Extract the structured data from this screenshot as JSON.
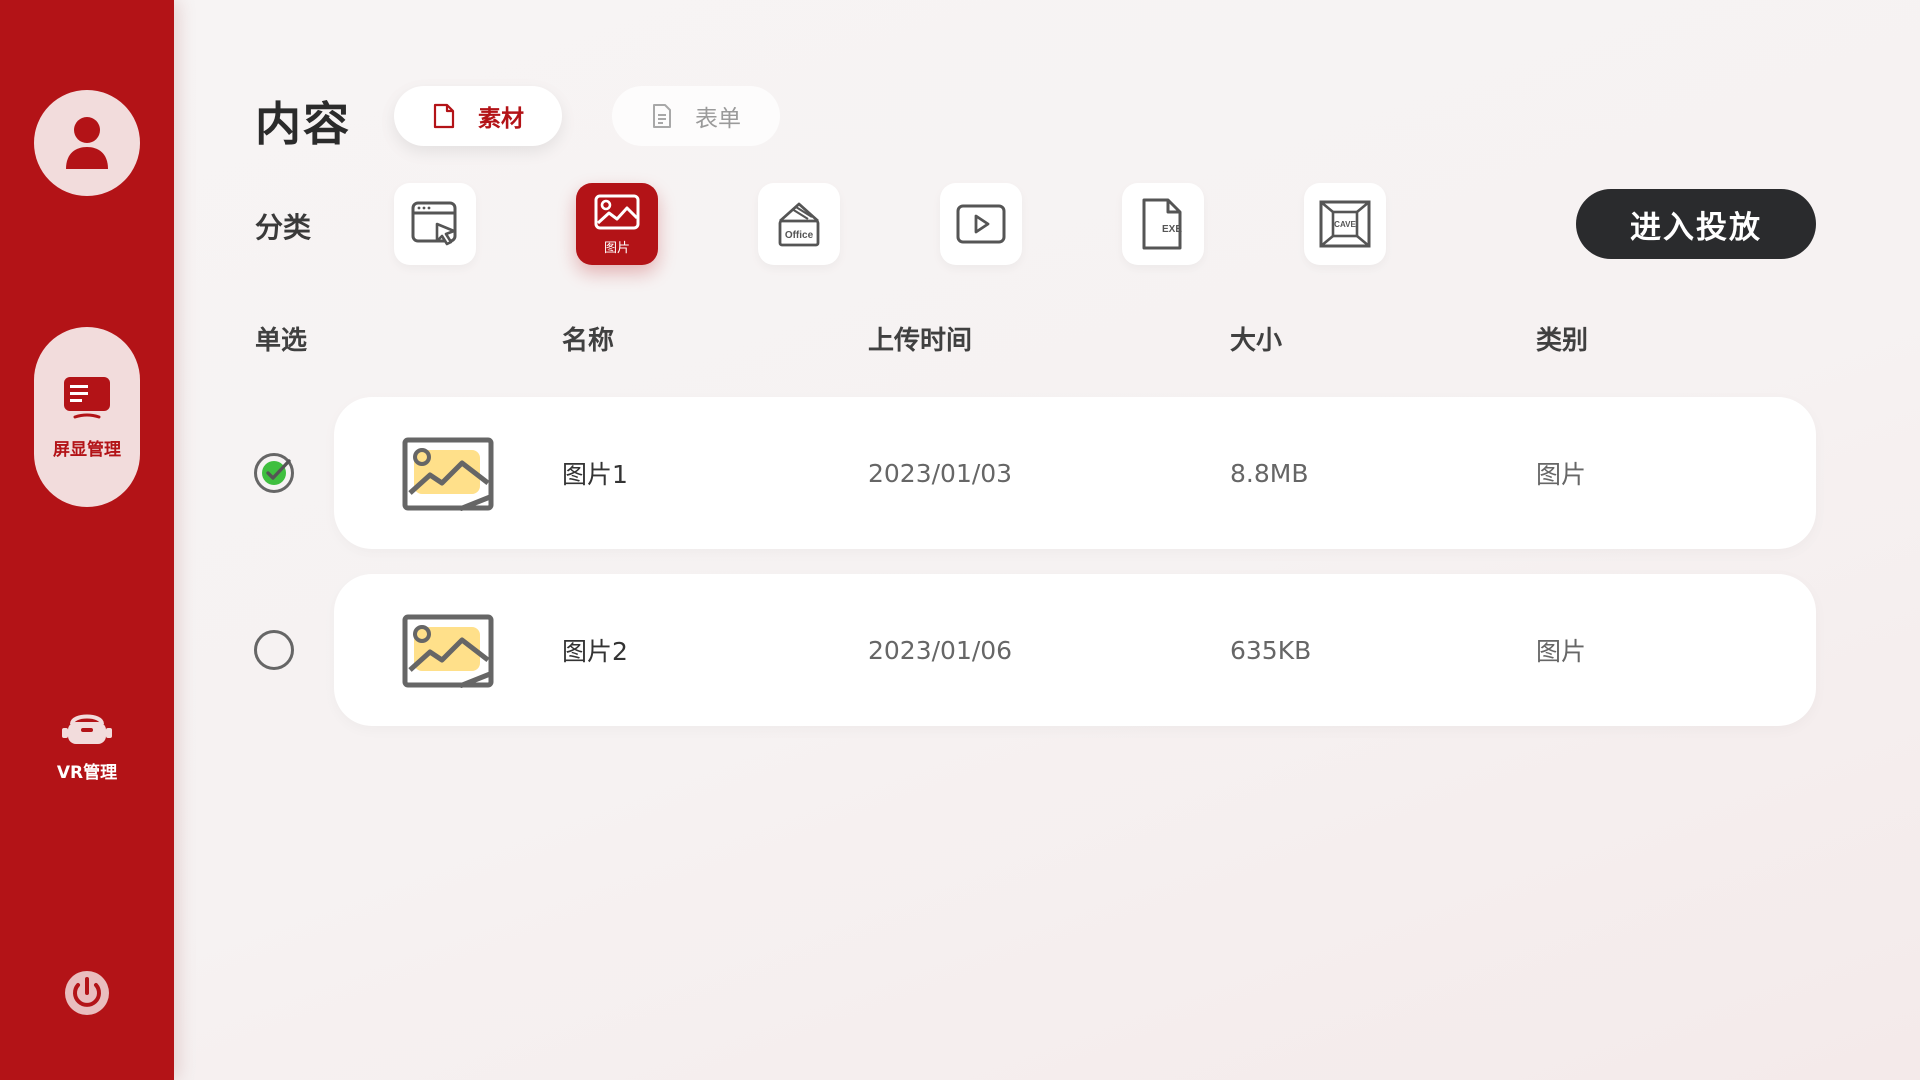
{
  "sidebar": {
    "items": [
      {
        "label": "屏显管理",
        "icon": "screen-display-icon",
        "active": true
      },
      {
        "label": "VR管理",
        "icon": "vr-headset-icon",
        "active": false
      }
    ],
    "avatar_icon": "user-avatar-icon",
    "power_icon": "power-icon"
  },
  "header": {
    "title": "内容",
    "tabs": [
      {
        "label": "素材",
        "icon": "file-icon",
        "active": true
      },
      {
        "label": "表单",
        "icon": "document-icon",
        "active": false
      }
    ]
  },
  "category": {
    "label": "分类",
    "items": [
      {
        "id": "web",
        "icon": "web-cursor-icon",
        "label": "",
        "active": false
      },
      {
        "id": "image",
        "icon": "image-icon",
        "label": "图片",
        "active": true
      },
      {
        "id": "office",
        "icon": "office-icon",
        "label": "",
        "active": false
      },
      {
        "id": "video",
        "icon": "video-play-icon",
        "label": "",
        "active": false
      },
      {
        "id": "exe",
        "icon": "exe-file-icon",
        "label": "",
        "active": false
      },
      {
        "id": "cave",
        "icon": "cave-icon",
        "label": "",
        "active": false
      }
    ],
    "icon_text": {
      "office": "Office",
      "exe": "EXE",
      "cave": "CAVE"
    },
    "launch_label": "进入投放"
  },
  "table": {
    "headers": [
      "单选",
      "名称",
      "上传时间",
      "大小",
      "类别"
    ],
    "rows": [
      {
        "selected": true,
        "name": "图片1",
        "date": "2023/01/03",
        "size": "8.8MB",
        "type": "图片"
      },
      {
        "selected": false,
        "name": "图片2",
        "date": "2023/01/06",
        "size": "635KB",
        "type": "图片"
      }
    ]
  },
  "colors": {
    "brand": "#b31317",
    "sidebar_pill": "#f2dcdc",
    "launch_button": "#2a2b2d",
    "check_green": "#3fbf3f",
    "thumb_fill": "#ffe08a"
  }
}
